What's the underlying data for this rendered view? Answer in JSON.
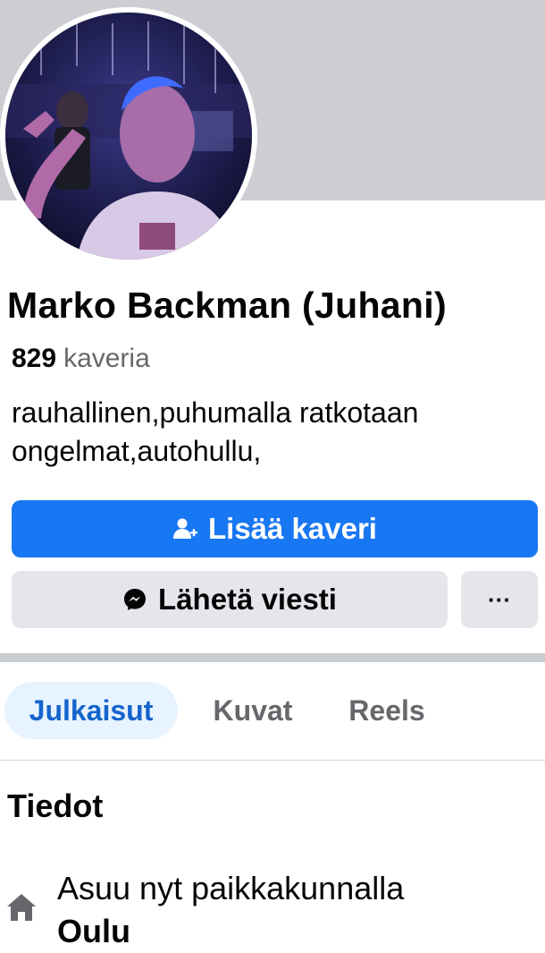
{
  "profile": {
    "name": "Marko Backman (Juhani)",
    "friends_count": "829",
    "friends_label": "kaveria",
    "bio": "rauhallinen,puhumalla ratkotaan ongelmat,autohullu,"
  },
  "actions": {
    "add_friend": "Lisää kaveri",
    "message": "Lähetä viesti",
    "more": "···"
  },
  "tabs": [
    {
      "label": "Julkaisut",
      "active": true
    },
    {
      "label": "Kuvat",
      "active": false
    },
    {
      "label": "Reels",
      "active": false
    }
  ],
  "details": {
    "title": "Tiedot",
    "lives_label": "Asuu nyt paikkakunnalla",
    "lives_city": "Oulu"
  },
  "colors": {
    "primary": "#1877f2",
    "secondary_button": "#e4e6eb",
    "active_tab_bg": "#e7f3ff",
    "active_tab_text": "#1464cc",
    "muted_text": "#65676b",
    "cover": "#ccced2"
  },
  "icons": {
    "add_friend": "add-friend-icon",
    "message": "messenger-icon",
    "home": "home-icon"
  }
}
